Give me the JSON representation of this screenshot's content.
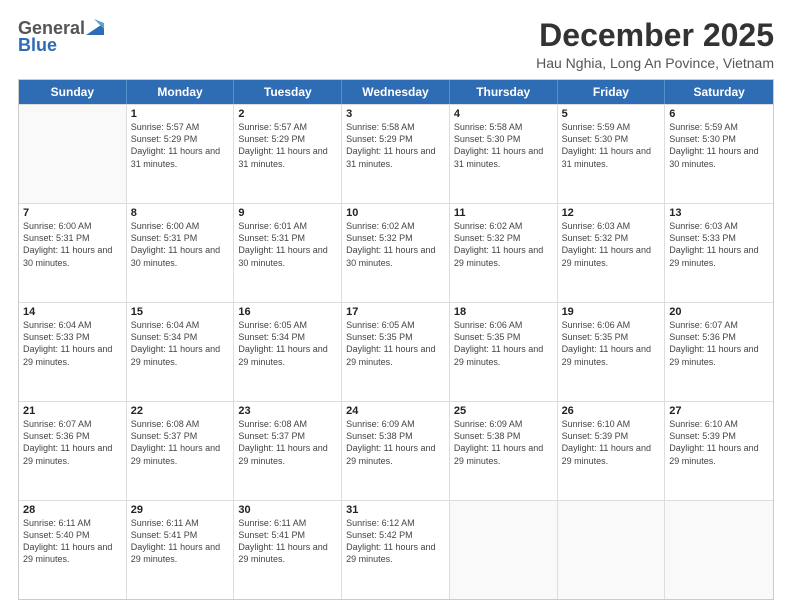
{
  "header": {
    "logo_general": "General",
    "logo_blue": "Blue",
    "month_title": "December 2025",
    "subtitle": "Hau Nghia, Long An Povince, Vietnam"
  },
  "days_of_week": [
    "Sunday",
    "Monday",
    "Tuesday",
    "Wednesday",
    "Thursday",
    "Friday",
    "Saturday"
  ],
  "weeks": [
    [
      {
        "day": "",
        "empty": true
      },
      {
        "day": "1",
        "sunrise": "5:57 AM",
        "sunset": "5:29 PM",
        "daylight": "11 hours and 31 minutes."
      },
      {
        "day": "2",
        "sunrise": "5:57 AM",
        "sunset": "5:29 PM",
        "daylight": "11 hours and 31 minutes."
      },
      {
        "day": "3",
        "sunrise": "5:58 AM",
        "sunset": "5:29 PM",
        "daylight": "11 hours and 31 minutes."
      },
      {
        "day": "4",
        "sunrise": "5:58 AM",
        "sunset": "5:30 PM",
        "daylight": "11 hours and 31 minutes."
      },
      {
        "day": "5",
        "sunrise": "5:59 AM",
        "sunset": "5:30 PM",
        "daylight": "11 hours and 31 minutes."
      },
      {
        "day": "6",
        "sunrise": "5:59 AM",
        "sunset": "5:30 PM",
        "daylight": "11 hours and 30 minutes."
      }
    ],
    [
      {
        "day": "7",
        "sunrise": "6:00 AM",
        "sunset": "5:31 PM",
        "daylight": "11 hours and 30 minutes."
      },
      {
        "day": "8",
        "sunrise": "6:00 AM",
        "sunset": "5:31 PM",
        "daylight": "11 hours and 30 minutes."
      },
      {
        "day": "9",
        "sunrise": "6:01 AM",
        "sunset": "5:31 PM",
        "daylight": "11 hours and 30 minutes."
      },
      {
        "day": "10",
        "sunrise": "6:02 AM",
        "sunset": "5:32 PM",
        "daylight": "11 hours and 30 minutes."
      },
      {
        "day": "11",
        "sunrise": "6:02 AM",
        "sunset": "5:32 PM",
        "daylight": "11 hours and 29 minutes."
      },
      {
        "day": "12",
        "sunrise": "6:03 AM",
        "sunset": "5:32 PM",
        "daylight": "11 hours and 29 minutes."
      },
      {
        "day": "13",
        "sunrise": "6:03 AM",
        "sunset": "5:33 PM",
        "daylight": "11 hours and 29 minutes."
      }
    ],
    [
      {
        "day": "14",
        "sunrise": "6:04 AM",
        "sunset": "5:33 PM",
        "daylight": "11 hours and 29 minutes."
      },
      {
        "day": "15",
        "sunrise": "6:04 AM",
        "sunset": "5:34 PM",
        "daylight": "11 hours and 29 minutes."
      },
      {
        "day": "16",
        "sunrise": "6:05 AM",
        "sunset": "5:34 PM",
        "daylight": "11 hours and 29 minutes."
      },
      {
        "day": "17",
        "sunrise": "6:05 AM",
        "sunset": "5:35 PM",
        "daylight": "11 hours and 29 minutes."
      },
      {
        "day": "18",
        "sunrise": "6:06 AM",
        "sunset": "5:35 PM",
        "daylight": "11 hours and 29 minutes."
      },
      {
        "day": "19",
        "sunrise": "6:06 AM",
        "sunset": "5:35 PM",
        "daylight": "11 hours and 29 minutes."
      },
      {
        "day": "20",
        "sunrise": "6:07 AM",
        "sunset": "5:36 PM",
        "daylight": "11 hours and 29 minutes."
      }
    ],
    [
      {
        "day": "21",
        "sunrise": "6:07 AM",
        "sunset": "5:36 PM",
        "daylight": "11 hours and 29 minutes."
      },
      {
        "day": "22",
        "sunrise": "6:08 AM",
        "sunset": "5:37 PM",
        "daylight": "11 hours and 29 minutes."
      },
      {
        "day": "23",
        "sunrise": "6:08 AM",
        "sunset": "5:37 PM",
        "daylight": "11 hours and 29 minutes."
      },
      {
        "day": "24",
        "sunrise": "6:09 AM",
        "sunset": "5:38 PM",
        "daylight": "11 hours and 29 minutes."
      },
      {
        "day": "25",
        "sunrise": "6:09 AM",
        "sunset": "5:38 PM",
        "daylight": "11 hours and 29 minutes."
      },
      {
        "day": "26",
        "sunrise": "6:10 AM",
        "sunset": "5:39 PM",
        "daylight": "11 hours and 29 minutes."
      },
      {
        "day": "27",
        "sunrise": "6:10 AM",
        "sunset": "5:39 PM",
        "daylight": "11 hours and 29 minutes."
      }
    ],
    [
      {
        "day": "28",
        "sunrise": "6:11 AM",
        "sunset": "5:40 PM",
        "daylight": "11 hours and 29 minutes."
      },
      {
        "day": "29",
        "sunrise": "6:11 AM",
        "sunset": "5:41 PM",
        "daylight": "11 hours and 29 minutes."
      },
      {
        "day": "30",
        "sunrise": "6:11 AM",
        "sunset": "5:41 PM",
        "daylight": "11 hours and 29 minutes."
      },
      {
        "day": "31",
        "sunrise": "6:12 AM",
        "sunset": "5:42 PM",
        "daylight": "11 hours and 29 minutes."
      },
      {
        "day": "",
        "empty": true
      },
      {
        "day": "",
        "empty": true
      },
      {
        "day": "",
        "empty": true
      }
    ]
  ]
}
